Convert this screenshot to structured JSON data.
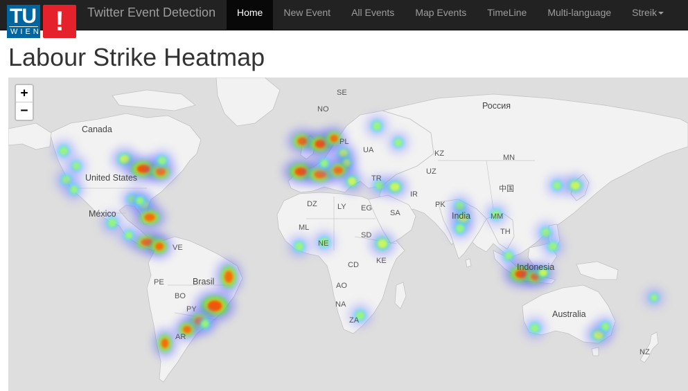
{
  "brand": {
    "logo_tu": "TU",
    "logo_wien": "WIEN",
    "logo_alert": "!",
    "title": "Twitter Event Detection"
  },
  "nav": {
    "home": "Home",
    "new_event": "New Event",
    "all_events": "All Events",
    "map_events": "Map Events",
    "timeline": "TimeLine",
    "multi_language": "Multi-language",
    "streik": "Streik"
  },
  "page": {
    "title": "Labour Strike Heatmap"
  },
  "map": {
    "zoom_in": "+",
    "zoom_out": "−",
    "labels": {
      "canada": "Canada",
      "united_states": "United States",
      "mexico": "México",
      "ve": "VE",
      "pe": "PE",
      "brasil": "Brasil",
      "bo": "BO",
      "py": "PY",
      "ar": "AR",
      "se": "SE",
      "no": "NO",
      "pl": "PL",
      "ua": "UA",
      "kz": "KZ",
      "russia": "Россия",
      "mn": "MN",
      "uz": "UZ",
      "tr": "TR",
      "ir": "IR",
      "dz": "DZ",
      "ly": "LY",
      "eg": "EG",
      "sa": "SA",
      "ml": "ML",
      "ne": "NE",
      "sd": "SD",
      "cd": "CD",
      "ke": "KE",
      "ao": "AO",
      "na": "NA",
      "za": "ZA",
      "pk": "PK",
      "india": "India",
      "china": "中国",
      "mm": "MM",
      "th": "TH",
      "indonesia": "Indonesia",
      "australia": "Australia",
      "nz": "NZ"
    },
    "colors": {
      "land": "#f2f2f2",
      "water": "#dedede",
      "border": "#b8b8b8"
    }
  }
}
